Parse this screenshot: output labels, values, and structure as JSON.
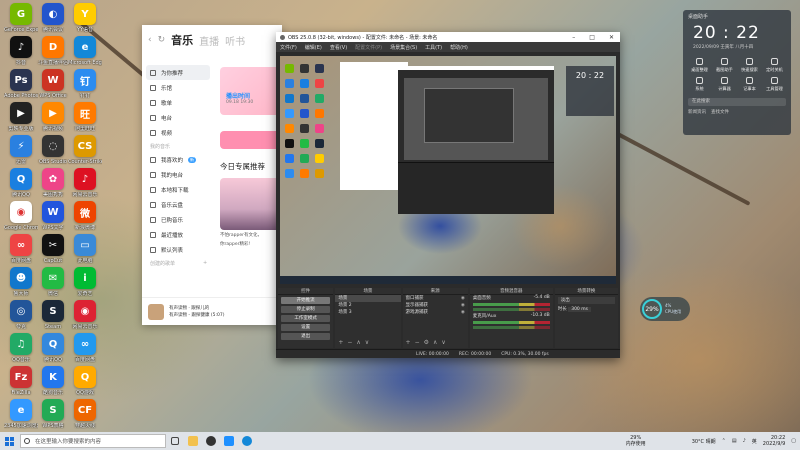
{
  "desktop_icons": [
    {
      "label": "GeForce Experience",
      "color": "#76b900",
      "glyph": "G"
    },
    {
      "label": "抖音",
      "color": "#111111",
      "glyph": "♪"
    },
    {
      "label": "Adobe Photosh..",
      "color": "#2a3450",
      "glyph": "Ps"
    },
    {
      "label": "剪映专业版",
      "color": "#222222",
      "glyph": "▶"
    },
    {
      "label": "迅雷",
      "color": "#2a80e0",
      "glyph": "⚡"
    },
    {
      "label": "腾讯QQ",
      "color": "#1a7fe0",
      "glyph": "Q"
    },
    {
      "label": "Google Chrome",
      "color": "#ffffff",
      "glyph": "◉"
    },
    {
      "label": "百度网盘",
      "color": "#e44",
      "glyph": "∞"
    },
    {
      "label": "鲁大师",
      "color": "#1177cc",
      "glyph": "☻"
    },
    {
      "label": "夸克",
      "color": "#225599",
      "glyph": "◎"
    },
    {
      "label": "QQ音乐",
      "color": "#22aa66",
      "glyph": "♫"
    },
    {
      "label": "FileZilla",
      "color": "#cc3333",
      "glyph": "Fz"
    },
    {
      "label": "2345加速浏览器",
      "color": "#3399ff",
      "glyph": "e"
    },
    {
      "label": "腾讯会议",
      "color": "#2255cc",
      "glyph": "◐"
    },
    {
      "label": "斗鱼直播伴侣",
      "color": "#ff7700",
      "glyph": "D"
    },
    {
      "label": "WPS Office",
      "color": "#cc3322",
      "glyph": "W"
    },
    {
      "label": "腾讯视频",
      "color": "#ff8800",
      "glyph": "▶"
    },
    {
      "label": "OBS Studio",
      "color": "#333333",
      "glyph": "◌"
    },
    {
      "label": "美图秀秀",
      "color": "#ee4488",
      "glyph": "✿"
    },
    {
      "label": "WPS文字",
      "color": "#2255dd",
      "glyph": "W"
    },
    {
      "label": "CapCut",
      "color": "#111111",
      "glyph": "✂"
    },
    {
      "label": "微信",
      "color": "#22bb44",
      "glyph": "✉"
    },
    {
      "label": "Steam",
      "color": "#1b2838",
      "glyph": "S"
    },
    {
      "label": "腾讯QQ",
      "color": "#3388dd",
      "glyph": "Q"
    },
    {
      "label": "酷狗音乐",
      "color": "#2277ee",
      "glyph": "K"
    },
    {
      "label": "WPS表格",
      "color": "#22aa55",
      "glyph": "S"
    },
    {
      "label": "YY语音",
      "color": "#ffcc00",
      "glyph": "Y"
    },
    {
      "label": "Microsoft Edge",
      "color": "#1388d8",
      "glyph": "e"
    },
    {
      "label": "钉钉",
      "color": "#2c8cf0",
      "glyph": "钉"
    },
    {
      "label": "阿里旺旺",
      "color": "#ff7a00",
      "glyph": "旺"
    },
    {
      "label": "Counter-Strike Global..",
      "color": "#dd9900",
      "glyph": "CS"
    },
    {
      "label": "网易云音乐",
      "color": "#dd1122",
      "glyph": "♪"
    },
    {
      "label": "新浪微博",
      "color": "#ee4400",
      "glyph": "微"
    },
    {
      "label": "此电脑",
      "color": "#3a8ad8",
      "glyph": "▭"
    },
    {
      "label": "爱奇艺",
      "color": "#00bb33",
      "glyph": "i"
    },
    {
      "label": "网易云音乐",
      "color": "#dd2233",
      "glyph": "◉"
    },
    {
      "label": "百度网盘",
      "color": "#2299ee",
      "glyph": "∞"
    },
    {
      "label": "QQ游戏",
      "color": "#ffaa00",
      "glyph": "Q"
    },
    {
      "label": "穿越火线",
      "color": "#ee6600",
      "glyph": "CF"
    }
  ],
  "music_app": {
    "tabs": [
      "音乐",
      "直播",
      "听书"
    ],
    "side_items": [
      {
        "label": "为你推荐",
        "active": true
      },
      {
        "label": "乐馆"
      },
      {
        "label": "歌单"
      },
      {
        "label": "电台"
      },
      {
        "label": "视频"
      }
    ],
    "my_music_heading": "我的音乐",
    "my_items": [
      {
        "label": "我喜欢的",
        "badge": "新"
      },
      {
        "label": "我的电台"
      },
      {
        "label": "本地和下载"
      },
      {
        "label": "音乐云盘"
      },
      {
        "label": "已购音乐"
      },
      {
        "label": "最近播放"
      },
      {
        "label": "默认列表"
      }
    ],
    "created_heading": "创建的歌单",
    "banner_title": "播出时间",
    "banner_sub": "09.18 19:30",
    "rec_title": "今日专属推荐",
    "rec_text_1": "不怕rapper有文化，",
    "rec_text_2": "你rapper精彩!",
    "player_text_1": "有声读物 · 跟探儿的",
    "player_text_2": "有声读物 - 跟探健康 (5:07)"
  },
  "obs": {
    "title": "OBS 25.0.8 (32-bit, windows) - 配置文件: 未命名 - 场景: 未命名",
    "menu": [
      "文件(F)",
      "编辑(E)",
      "查看(V)",
      "配置文件(P)",
      "场景集合(S)",
      "工具(T)",
      "帮助(H)"
    ],
    "docks": {
      "controls_head": "控件",
      "controls_buttons": [
        "开始推流",
        "停止录制",
        "工作室模式",
        "设置",
        "退出"
      ],
      "scenes_head": "场景",
      "scenes": [
        "场景",
        "场景 2",
        "场景 3"
      ],
      "sources_head": "来源",
      "sources": [
        "窗口捕获",
        "显示器捕获",
        "游戏源捕获"
      ],
      "mixer_head": "音频混音器",
      "mixer": [
        {
          "name": "桌面音频",
          "level": "-5.4 dB"
        },
        {
          "name": "麦克风/Aux",
          "level": "-10.3 dB"
        }
      ],
      "transitions_head": "场景转换",
      "transition_name": "淡出",
      "duration_label": "时长",
      "duration_value": "300 ms"
    },
    "status": {
      "live": "LIVE: 00:00:00",
      "rec": "REC: 00:00:00",
      "cpu": "CPU: 0.3%, 30.00 fps"
    }
  },
  "clock_widget": {
    "header": "桌面助手",
    "time": "20 : 22",
    "date": "2022/09/09",
    "lunar": "壬寅年  八月十四",
    "buttons": [
      "桌面整理",
      "截图助手",
      "快速搜索",
      "定时关机",
      "系统",
      "计算器",
      "记事本",
      "工具管理"
    ],
    "search_placeholder": "在此搜索",
    "links": [
      "新闻资讯",
      "查找文件"
    ]
  },
  "cpu_widget": {
    "percent": "29",
    "unit": "%",
    "label_1": "4%",
    "label_2": "CPU使用"
  },
  "taskbar": {
    "search_placeholder": "在这里输入你要搜索的内容",
    "cpu_percent": "29%",
    "cpu_label": "内存使用",
    "weather": "30°C 晴朗",
    "ime": "英",
    "time": "20:22",
    "date": "2022/9/9"
  }
}
